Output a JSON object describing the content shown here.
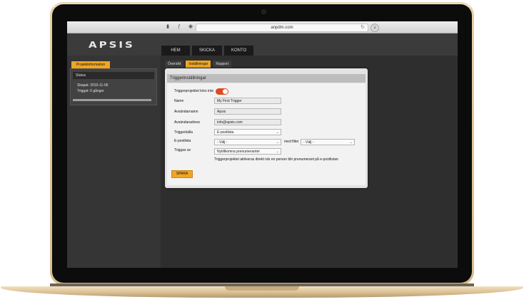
{
  "browser": {
    "url": "anpdm.com",
    "reload_icon": "reload-icon",
    "buttons": [
      "sidebar-icon",
      "bookmark-icon",
      "history-icon"
    ]
  },
  "header": {
    "logo": "APSIS",
    "nav": [
      "HEM",
      "SKICKA",
      "KONTO"
    ]
  },
  "left": {
    "tab": "Projektinformation",
    "status_label": "Status",
    "created": "Skapat: 2015-11-06",
    "triggered": "Triggat: 0 gånger"
  },
  "subtabs": [
    "Översikt",
    "Inställningar",
    "Rapport"
  ],
  "form": {
    "title": "Triggerinställningar",
    "toggle_label": "Triggerprojektet körs inte",
    "toggle_on": true,
    "name_label": "Namn",
    "name_value": "My First Trigger",
    "sender_name_label": "Avsändarnamn",
    "sender_name_value": "Apsis",
    "sender_address_label": "Avsändaradress",
    "sender_address_value": "info@apsis.com",
    "source_label": "Triggerkälla",
    "source_value": "E-postlista",
    "list_label": "E-postlista",
    "list_value": "- Välj -",
    "filter_label": "med filter",
    "filter_value": "- Välj -",
    "triggered_by_label": "Triggas av",
    "triggered_by_value": "Nytillkomna prenumeranter",
    "hint": "Triggerprojektet aktiveras direkt när en person blir prenumerant på e-postlistan",
    "save": "SPARA"
  },
  "colors": {
    "accent": "#f0a623",
    "toggle": "#dd4a22"
  }
}
